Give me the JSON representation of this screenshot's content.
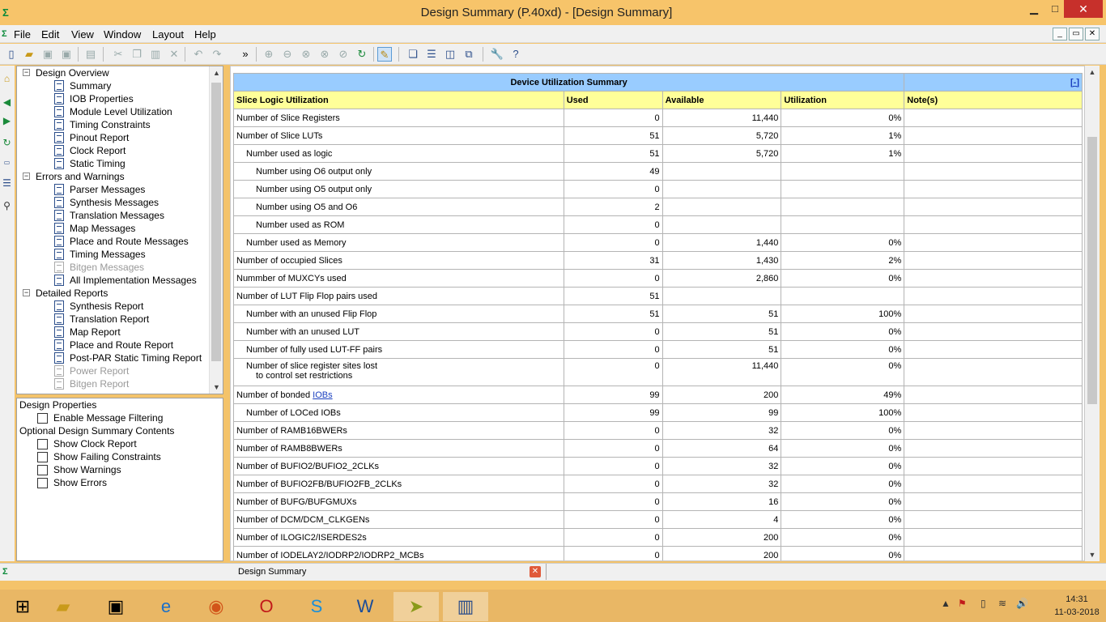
{
  "window": {
    "title": "Design Summary (P.40xd) - [Design Summary]",
    "min": "▁",
    "max": "□",
    "close": "✕"
  },
  "menu": [
    "File",
    "Edit",
    "View",
    "Window",
    "Layout",
    "Help"
  ],
  "mdi_controls": [
    "_",
    "▭",
    "✕"
  ],
  "tree": {
    "items": [
      {
        "type": "group",
        "label": "Design Overview"
      },
      {
        "type": "leaf",
        "label": "Summary",
        "state": "selected"
      },
      {
        "type": "leaf",
        "label": "IOB Properties"
      },
      {
        "type": "leaf",
        "label": "Module Level Utilization"
      },
      {
        "type": "leaf",
        "label": "Timing Constraints"
      },
      {
        "type": "leaf",
        "label": "Pinout Report"
      },
      {
        "type": "leaf",
        "label": "Clock Report"
      },
      {
        "type": "leaf",
        "label": "Static Timing"
      },
      {
        "type": "group",
        "label": "Errors and Warnings"
      },
      {
        "type": "leaf",
        "label": "Parser Messages"
      },
      {
        "type": "leaf",
        "label": "Synthesis Messages"
      },
      {
        "type": "leaf",
        "label": "Translation Messages"
      },
      {
        "type": "leaf",
        "label": "Map Messages"
      },
      {
        "type": "leaf",
        "label": "Place and Route Messages"
      },
      {
        "type": "leaf",
        "label": "Timing Messages"
      },
      {
        "type": "leaf",
        "label": "Bitgen Messages",
        "state": "disabled"
      },
      {
        "type": "leaf",
        "label": "All Implementation Messages"
      },
      {
        "type": "group",
        "label": "Detailed Reports"
      },
      {
        "type": "leaf",
        "label": "Synthesis Report"
      },
      {
        "type": "leaf",
        "label": "Translation Report"
      },
      {
        "type": "leaf",
        "label": "Map Report"
      },
      {
        "type": "leaf",
        "label": "Place and Route Report"
      },
      {
        "type": "leaf",
        "label": "Post-PAR Static Timing Report"
      },
      {
        "type": "leaf",
        "label": "Power Report",
        "state": "disabled"
      },
      {
        "type": "leaf",
        "label": "Bitgen Report",
        "state": "disabled"
      }
    ]
  },
  "properties": {
    "design_properties": "Design Properties",
    "enable_filtering": "Enable Message Filtering",
    "optional_contents": "Optional Design Summary Contents",
    "options": [
      "Show Clock Report",
      "Show Failing Constraints",
      "Show Warnings",
      "Show Errors"
    ]
  },
  "summary": {
    "title": "Device Utilization Summary",
    "toggle": "[-]",
    "headers": [
      "Slice Logic Utilization",
      "Used",
      "Available",
      "Utilization",
      "Note(s)"
    ],
    "rows": [
      {
        "label": "Number of Slice Registers",
        "indent": 0,
        "used": "0",
        "available": "11,440",
        "util": "0%"
      },
      {
        "label": "Number of Slice LUTs",
        "indent": 0,
        "used": "51",
        "available": "5,720",
        "util": "1%"
      },
      {
        "label": "Number used as logic",
        "indent": 1,
        "used": "51",
        "available": "5,720",
        "util": "1%"
      },
      {
        "label": "Number using O6 output only",
        "indent": 2,
        "used": "49",
        "available": "",
        "util": ""
      },
      {
        "label": "Number using O5 output only",
        "indent": 2,
        "used": "0",
        "available": "",
        "util": ""
      },
      {
        "label": "Number using O5 and O6",
        "indent": 2,
        "used": "2",
        "available": "",
        "util": ""
      },
      {
        "label": "Number used as ROM",
        "indent": 2,
        "used": "0",
        "available": "",
        "util": ""
      },
      {
        "label": "Number used as Memory",
        "indent": 1,
        "used": "0",
        "available": "1,440",
        "util": "0%"
      },
      {
        "label": "Number of occupied Slices",
        "indent": 0,
        "used": "31",
        "available": "1,430",
        "util": "2%"
      },
      {
        "label": "Nummber of MUXCYs used",
        "indent": 0,
        "used": "0",
        "available": "2,860",
        "util": "0%"
      },
      {
        "label": "Number of LUT Flip Flop pairs used",
        "indent": 0,
        "used": "51",
        "available": "",
        "util": ""
      },
      {
        "label": "Number with an unused Flip Flop",
        "indent": 1,
        "used": "51",
        "available": "51",
        "util": "100%"
      },
      {
        "label": "Number with an unused LUT",
        "indent": 1,
        "used": "0",
        "available": "51",
        "util": "0%"
      },
      {
        "label": "Number of fully used LUT-FF pairs",
        "indent": 1,
        "used": "0",
        "available": "51",
        "util": "0%"
      },
      {
        "label": "Number of slice register sites lost",
        "label2": "to control set restrictions",
        "indent": 1,
        "used": "0",
        "available": "11,440",
        "util": "0%"
      },
      {
        "label": "Number of bonded ",
        "link": "IOBs",
        "indent": 0,
        "used": "99",
        "available": "200",
        "util": "49%"
      },
      {
        "label": "Number of LOCed IOBs",
        "indent": 1,
        "used": "99",
        "available": "99",
        "util": "100%"
      },
      {
        "label": "Number of RAMB16BWERs",
        "indent": 0,
        "used": "0",
        "available": "32",
        "util": "0%"
      },
      {
        "label": "Number of RAMB8BWERs",
        "indent": 0,
        "used": "0",
        "available": "64",
        "util": "0%"
      },
      {
        "label": "Number of BUFIO2/BUFIO2_2CLKs",
        "indent": 0,
        "used": "0",
        "available": "32",
        "util": "0%"
      },
      {
        "label": "Number of BUFIO2FB/BUFIO2FB_2CLKs",
        "indent": 0,
        "used": "0",
        "available": "32",
        "util": "0%"
      },
      {
        "label": "Number of BUFG/BUFGMUXs",
        "indent": 0,
        "used": "0",
        "available": "16",
        "util": "0%"
      },
      {
        "label": "Number of DCM/DCM_CLKGENs",
        "indent": 0,
        "used": "0",
        "available": "4",
        "util": "0%"
      },
      {
        "label": "Number of ILOGIC2/ISERDES2s",
        "indent": 0,
        "used": "0",
        "available": "200",
        "util": "0%"
      },
      {
        "label": "Number of IODELAY2/IODRP2/IODRP2_MCBs",
        "indent": 0,
        "used": "0",
        "available": "200",
        "util": "0%"
      }
    ]
  },
  "bottom_tab": {
    "label": "Design Summary",
    "close": "✕"
  },
  "taskbar": {
    "time": "14:31",
    "date": "11-03-2018"
  }
}
